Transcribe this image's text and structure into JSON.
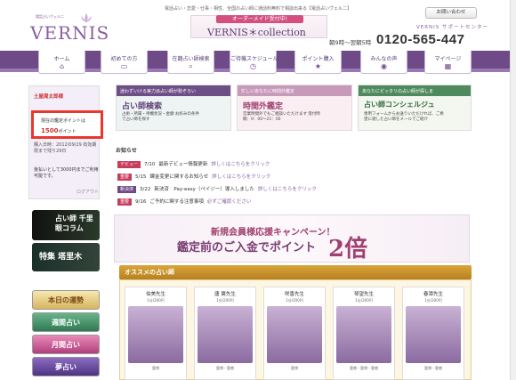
{
  "header": {
    "tagline": "電話占い・恋愛・仕事・相性、全国の占い師に通話料無料で相談出来る【電話占いヴェルニ】",
    "logo_small": "電話占いヴェルニ",
    "logo_big": "VERNIS",
    "banner_ribbon": "オーダーメイド受付中!",
    "banner_text": "VERNIS＊collection",
    "contact_label": "お問い合わせ",
    "support_label": "VERNIS サポートセンター",
    "hours": "朝9時〜翌朝5時",
    "phone": "0120-565-447"
  },
  "nav": [
    {
      "label": "ホーム",
      "icon": "⌂",
      "icon_name": "home-icon"
    },
    {
      "label": "初めての方",
      "icon": "▭",
      "icon_name": "monitor-icon"
    },
    {
      "label": "在籍占い師検索",
      "icon": "⌕",
      "icon_name": "search-icon"
    },
    {
      "label": "ご待機スケジュール",
      "icon": "◷",
      "icon_name": "clock-icon"
    },
    {
      "label": "ポイント購入",
      "icon": "★",
      "icon_name": "star-icon"
    },
    {
      "label": "みんなの声",
      "icon": "◉",
      "icon_name": "speech-icon"
    },
    {
      "label": "マイページ",
      "icon": "▦",
      "icon_name": "grid-icon"
    }
  ],
  "sidebar": {
    "user_name": "土屋周太郎様",
    "points_label": "現在の鑑定ポイントは",
    "points_value": "1500",
    "points_unit": "ポイント",
    "expiry_text": "購入日時：2012/09/29 有効期限まで残り29日",
    "post_text": "後払いとして3000円までご利用可能です。",
    "logout": "ログアウト",
    "column_label": "占い師 千里眼コラム",
    "feature_label": "特集 塔里木",
    "menu": [
      "本日の運勢",
      "週間占い",
      "月間占い",
      "夢占い"
    ]
  },
  "topcards": [
    {
      "header": "迷わずいける実力派占い師が勢ぞろい",
      "title": "占い師検索",
      "sub": "占術・所属・待機状況・金額 お好みの条件で占い師を探す",
      "color": "#7a5a92"
    },
    {
      "header": "忙しいあなたに時間外鑑定",
      "title": "時間外鑑定",
      "sub": "営業時間外でもご相談いただけます 受付時間：9：00〜21：00",
      "color": "#b65e8c"
    },
    {
      "header": "あなたにピッタリの占い師が探しま",
      "title": "占い師コンシェルジュ",
      "sub": "専用フォームからお送りいただければ、ご希望に適した占い師をメールでご紹介",
      "color": "#4f8a5f"
    }
  ],
  "news": {
    "heading": "お知らせ",
    "items": [
      {
        "tag": "デビュー",
        "date": "7/10",
        "text": "最新デビュー情報更新",
        "link": "詳しくはこちらをクリック"
      },
      {
        "tag": "重要",
        "date": "5/15",
        "text": "課金変更に関するお知らせ",
        "link": "詳しくはこちらをクリック"
      },
      {
        "tag": "新決済",
        "date": "3/22",
        "text": "新決済　Pay-easy（ペイジー）導入しました",
        "link": "詳しくはこちらをクリック"
      },
      {
        "tag": "重要",
        "date": "9/16",
        "text": "ご予約に関する注意事項",
        "link": "必ずご確認ください"
      }
    ]
  },
  "campaign": {
    "line1": "新規会員様応援キャンペーン！",
    "line2": "鑑定前のご入金でポイント",
    "line3": "2倍"
  },
  "osusume": {
    "heading": "オススメの占い師",
    "cards": [
      {
        "name": "伯美先生",
        "cost": "1分/200円",
        "cat": "霊視"
      },
      {
        "name": "唐 翼先生",
        "cost": "1分/200円",
        "cat": "霊視・霊感"
      },
      {
        "name": "咲香先生",
        "cost": "1分/200円",
        "cat": "霊視"
      },
      {
        "name": "琴望先生",
        "cost": "1分/200円",
        "cat": "霊感・霊視・霊感"
      },
      {
        "name": "春潭先生",
        "cost": "1分/200円",
        "cat": "霊視・霊感"
      }
    ]
  }
}
